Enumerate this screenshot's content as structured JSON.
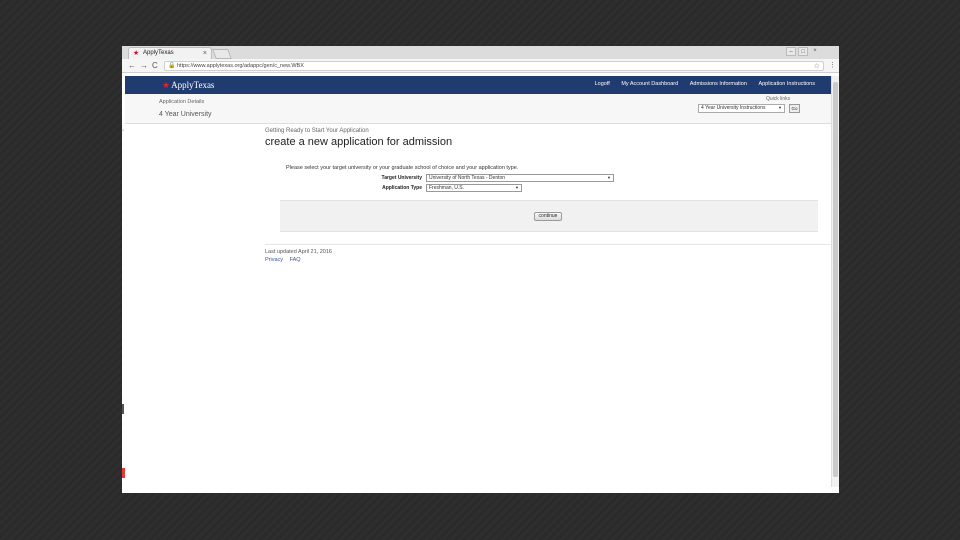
{
  "browser": {
    "tab_title": "ApplyTexas",
    "tab_close": "×",
    "url": "https://www.applytexas.org/adappc/gen/c_new.WBX",
    "nav_back": "←",
    "nav_forward": "→",
    "nav_reload": "C",
    "win_min": "–",
    "win_max": "□",
    "win_close": "×",
    "menu": "⋮"
  },
  "site": {
    "logo_text": "ApplyTexas",
    "nav": [
      "Logoff",
      "My Account Dashboard",
      "Admissions Information",
      "Application Instructions"
    ]
  },
  "subbar": {
    "crumb": "Application Details",
    "app_name": "4 Year University",
    "quick_links_label": "Quick links",
    "quick_select_value": "4 Year University Instructions",
    "go_label": "Go"
  },
  "main": {
    "kicker": "Getting Ready to Start Your Application",
    "title": "create a new application for admission",
    "prompt": "Please select your target university or your graduate school of choice and your application type.",
    "target_university_label": "Target University",
    "target_university_value": "University of North Texas - Denton",
    "application_type_label": "Application Type",
    "application_type_value": "Freshman, U.S.",
    "continue_label": "continue"
  },
  "footer": {
    "updated": "Last updated April 21, 2016",
    "links": [
      "Privacy",
      "FAQ"
    ]
  },
  "colors": {
    "header_bg": "#1f3b70",
    "logo_star": "#d9252b"
  }
}
